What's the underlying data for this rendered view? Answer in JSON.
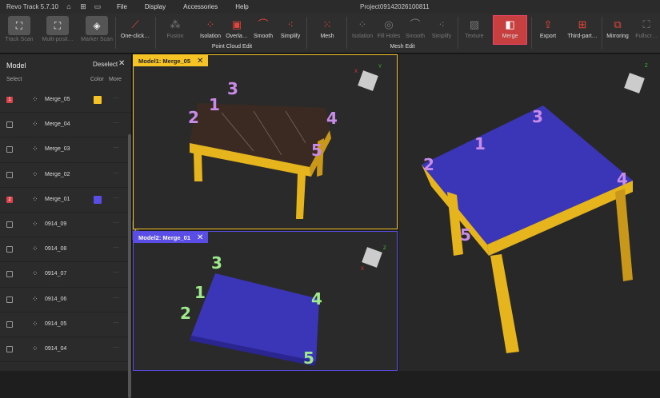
{
  "titlebar": {
    "app": "Revo Track 5.7.10",
    "menus": [
      "File",
      "Display",
      "Accessories",
      "Help"
    ],
    "project": "Project09142026100811",
    "icons": [
      "home-icon",
      "add-file-icon",
      "folder-icon"
    ]
  },
  "toolbar": {
    "track_scan": "Track Scan",
    "multi_position": "Multi-posit…",
    "marker_scan": "Marker Scan",
    "one_click": "One-click…",
    "fusion": "Fusion",
    "isolation": "Isolation",
    "overlap": "Overla…",
    "smooth": "Smooth",
    "simplify": "Simplify",
    "mesh": "Mesh",
    "mesh_isolation": "Isolation",
    "fill_holes": "Fill Holes",
    "mesh_smooth": "Smooth",
    "mesh_simplify": "Simplify",
    "texture": "Texture",
    "merge": "Merge",
    "export": "Export",
    "third_party": "Third-part…",
    "mirroring": "Mirroring",
    "fullscreen": "Fullscr…",
    "group_point_cloud": "Point Cloud Edit",
    "group_mesh": "Mesh Edit"
  },
  "panel": {
    "title": "Model",
    "deselect": "Deselect",
    "col_select": "Select",
    "col_color": "Color",
    "col_more": "More",
    "rows": [
      {
        "badge": "1",
        "checked": true,
        "name": "Merge_05",
        "color": "#f5c324"
      },
      {
        "badge": "",
        "checked": false,
        "name": "Merge_04",
        "color": ""
      },
      {
        "badge": "",
        "checked": false,
        "name": "Merge_03",
        "color": ""
      },
      {
        "badge": "",
        "checked": false,
        "name": "Merge_02",
        "color": ""
      },
      {
        "badge": "2",
        "checked": true,
        "name": "Merge_01",
        "color": "#5a4de6"
      },
      {
        "badge": "",
        "checked": false,
        "name": "0914_09",
        "color": ""
      },
      {
        "badge": "",
        "checked": false,
        "name": "0914_08",
        "color": ""
      },
      {
        "badge": "",
        "checked": false,
        "name": "0914_07",
        "color": ""
      },
      {
        "badge": "",
        "checked": false,
        "name": "0914_06",
        "color": ""
      },
      {
        "badge": "",
        "checked": false,
        "name": "0914_05",
        "color": ""
      },
      {
        "badge": "",
        "checked": false,
        "name": "0914_04",
        "color": ""
      }
    ],
    "more_glyph": "···"
  },
  "viewports": {
    "model1_label": "Model1: Merge_05",
    "model2_label": "Model2: Merge_01",
    "model1_color": "#f5c324",
    "model2_color": "#5a4de6",
    "point_labels": [
      "1",
      "2",
      "3",
      "4",
      "5"
    ],
    "model1_label_color": "#c98be8",
    "model2_label_color": "#9fea8c",
    "merged_label_color": "#c98be8"
  },
  "colors": {
    "accent_red": "#c83f3f",
    "table_yellow": "#e6b51e",
    "table_blue": "#3b36b8"
  }
}
